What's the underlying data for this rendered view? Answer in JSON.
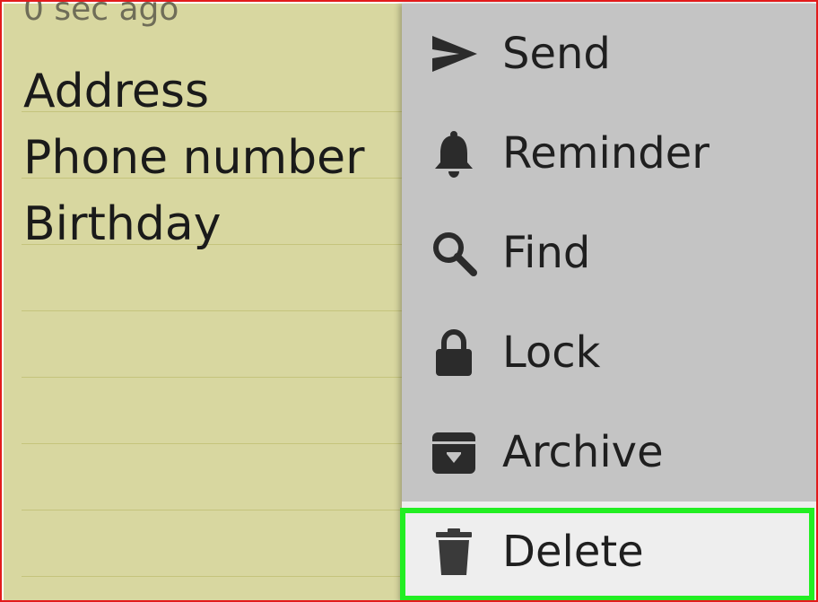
{
  "note": {
    "timestamp": "0 sec ago",
    "lines": [
      "Address",
      "Phone number",
      "Birthday"
    ]
  },
  "menu": {
    "items": [
      {
        "label": "Send",
        "icon": "send-icon"
      },
      {
        "label": "Reminder",
        "icon": "bell-icon"
      },
      {
        "label": "Find",
        "icon": "search-icon"
      },
      {
        "label": "Lock",
        "icon": "lock-icon"
      },
      {
        "label": "Archive",
        "icon": "archive-icon"
      },
      {
        "label": "Delete",
        "icon": "trash-icon"
      }
    ],
    "highlighted": "Delete"
  },
  "colors": {
    "note_background": "#d8d7a0",
    "menu_background": "#c4c4c4",
    "highlight_border": "#22ee22",
    "frame_border": "#e21b1b"
  }
}
